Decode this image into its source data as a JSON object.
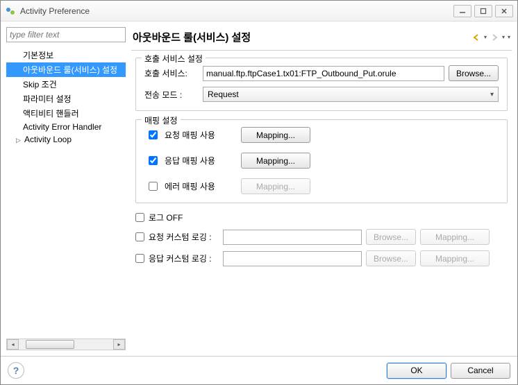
{
  "window": {
    "title": "Activity Preference"
  },
  "sidebar": {
    "filter_placeholder": "type filter text",
    "items": [
      {
        "label": "기본정보",
        "selected": false
      },
      {
        "label": "아웃바운드 룰(서비스) 설정",
        "selected": true
      },
      {
        "label": "Skip 조건",
        "selected": false
      },
      {
        "label": "파라미터 설정",
        "selected": false
      },
      {
        "label": "액티비티 핸들러",
        "selected": false
      },
      {
        "label": "Activity Error Handler",
        "selected": false
      },
      {
        "label": "Activity Loop",
        "selected": false,
        "has_children": true
      }
    ]
  },
  "header": {
    "title": "아웃바운드 룰(서비스) 설정"
  },
  "call_service": {
    "legend": "호출 서비스 설정",
    "service_label": "호출 서비스:",
    "service_value": "manual.ftp.ftpCase1.tx01:FTP_Outbound_Put.orule",
    "browse_label": "Browse...",
    "mode_label": "전송 모드 :",
    "mode_value": "Request"
  },
  "mapping": {
    "legend": "매핑 설정",
    "request_label": "요청 매핑 사용",
    "request_checked": true,
    "response_label": "응답 매핑 사용",
    "response_checked": true,
    "error_label": "에러 매핑 사용",
    "error_checked": false,
    "mapping_btn": "Mapping..."
  },
  "log": {
    "log_off_label": "로그 OFF",
    "log_off_checked": false,
    "req_log_label": "요청 커스텀 로깅 :",
    "req_log_checked": false,
    "req_log_value": "",
    "res_log_label": "응답 커스텀 로깅 :",
    "res_log_checked": false,
    "res_log_value": "",
    "browse_label": "Browse...",
    "mapping_label": "Mapping..."
  },
  "footer": {
    "ok_label": "OK",
    "cancel_label": "Cancel"
  }
}
